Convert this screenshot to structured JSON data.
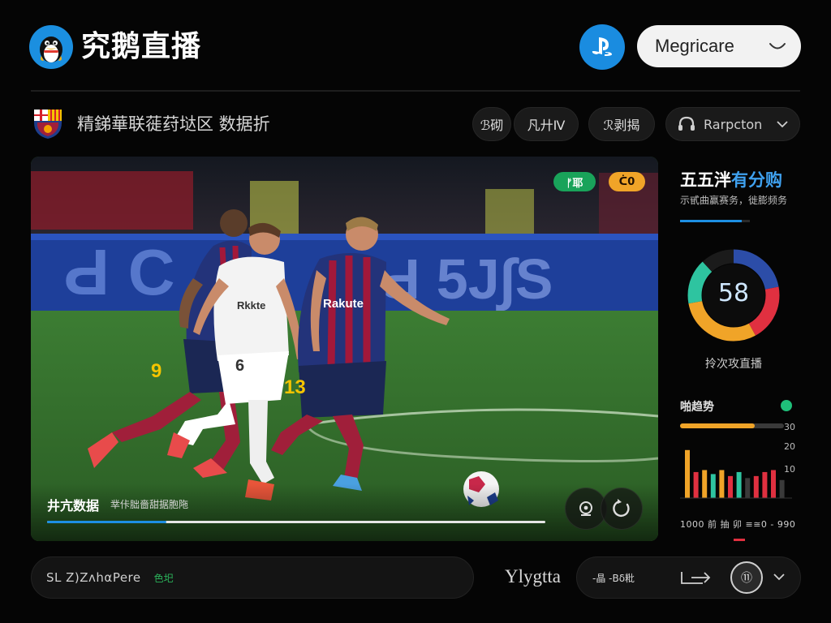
{
  "app": {
    "title": "究鹅直播"
  },
  "header": {
    "account_select_label": "Megricare"
  },
  "match": {
    "title": "精銻華联蓰荮垯区 数据折",
    "chips": [
      "ℬ砌",
      "凡廾Ⅳ",
      "ℛ剥揭"
    ],
    "channel_select_label": "Rarpcton"
  },
  "video": {
    "tag_green": "ᚠ耶",
    "tag_orange": "ᑖ0",
    "caption": "井亢数据",
    "subcaption": "丵佧胐嗇甜据胞陁",
    "jersey_text": "Rakute",
    "jersey_text_white": "Rkkte",
    "player_numbers": [
      "9",
      "6",
      "13"
    ],
    "progress": 0.24
  },
  "panel": {
    "title_main": "五五泮",
    "title_highlight": "有分购",
    "subtitle": "示甙曲赢赛务，徙膨频务",
    "donut_value": "58",
    "donut_label": "拎次攻直播",
    "trend_label": "啪趋势",
    "trend_progress": 0.72,
    "trend_ticks": [
      "30",
      "20",
      "10"
    ],
    "footer_text": "1000 前 抽  卯  ≡≅0 - 990"
  },
  "bottom": {
    "search_text": "⁠SL Z⁠)⁠Ζ⁠ᴧ⁠hαPere",
    "search_tag": "色圯",
    "brand": "Ylygtta",
    "ctrl_a": "-晶 -Bδ粃",
    "ctrl_c": "⑪"
  },
  "colors": {
    "accent_blue": "#1a8ce0",
    "green": "#19a35a",
    "orange": "#f0a428",
    "red": "#e03040",
    "teal": "#2ec4a0",
    "background": "#050505"
  },
  "chart_data": {
    "type": "donut",
    "center_value": 58,
    "segments": [
      {
        "color": "#2c4da8",
        "value": 22
      },
      {
        "color": "#e03040",
        "value": 20
      },
      {
        "color": "#f0a428",
        "value": 30
      },
      {
        "color": "#2ec4a0",
        "value": 16
      },
      {
        "color": "#1b1b1b",
        "value": 12
      }
    ],
    "mini_bars": {
      "ylim": [
        0,
        30
      ],
      "ticks": [
        30,
        20,
        10
      ],
      "bars": [
        {
          "value": 24,
          "color": "#f0a428"
        },
        {
          "value": 13,
          "color": "#e03040"
        },
        {
          "value": 14,
          "color": "#f0a428"
        },
        {
          "value": 12,
          "color": "#2ec4a0"
        },
        {
          "value": 14,
          "color": "#f0a428"
        },
        {
          "value": 11,
          "color": "#e03040"
        },
        {
          "value": 13,
          "color": "#2ec4a0"
        },
        {
          "value": 10,
          "color": "#3a3a3a"
        },
        {
          "value": 11,
          "color": "#e03040"
        },
        {
          "value": 13,
          "color": "#e03040"
        },
        {
          "value": 14,
          "color": "#e03040"
        },
        {
          "value": 9,
          "color": "#3a3a3a"
        }
      ]
    }
  }
}
